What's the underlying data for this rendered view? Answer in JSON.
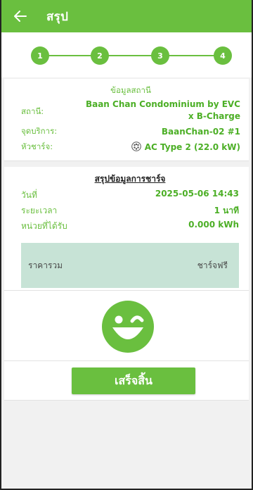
{
  "appbar": {
    "title": "สรุป"
  },
  "stepper": {
    "steps": [
      "1",
      "2",
      "3",
      "4"
    ]
  },
  "station": {
    "title": "ข้อมูลสถานี",
    "station_label": "สถานี:",
    "station_name_line1": "Baan Chan Condominium by EVC",
    "station_name_line2": "x B-Charge",
    "point_label": "จุดบริการ:",
    "point_value": "BaanChan-02 #1",
    "connector_label": "หัวชาร์จ:",
    "connector_value": "AC Type 2 (22.0 kW)"
  },
  "summary": {
    "title": "สรุปข้อมูลการชาร์จ",
    "date_label": "วันที่",
    "date_value": "2025-05-06 14:43",
    "duration_label": "ระยะเวลา",
    "duration_value": "1 นาที",
    "energy_label": "หน่วยที่ได้รับ",
    "energy_value": "0.000 kWh",
    "total_label": "ราคารวม",
    "total_value": "ชาร์จฟรี"
  },
  "actions": {
    "done_label": "เสร็จสิ้น"
  },
  "colors": {
    "primary": "#6abf3f",
    "accent_text": "#4caf26",
    "total_bg": "#c7e3d6"
  },
  "icons": {
    "back": "arrow-left-icon",
    "connector": "type2-connector-icon",
    "face": "winking-face-icon"
  }
}
